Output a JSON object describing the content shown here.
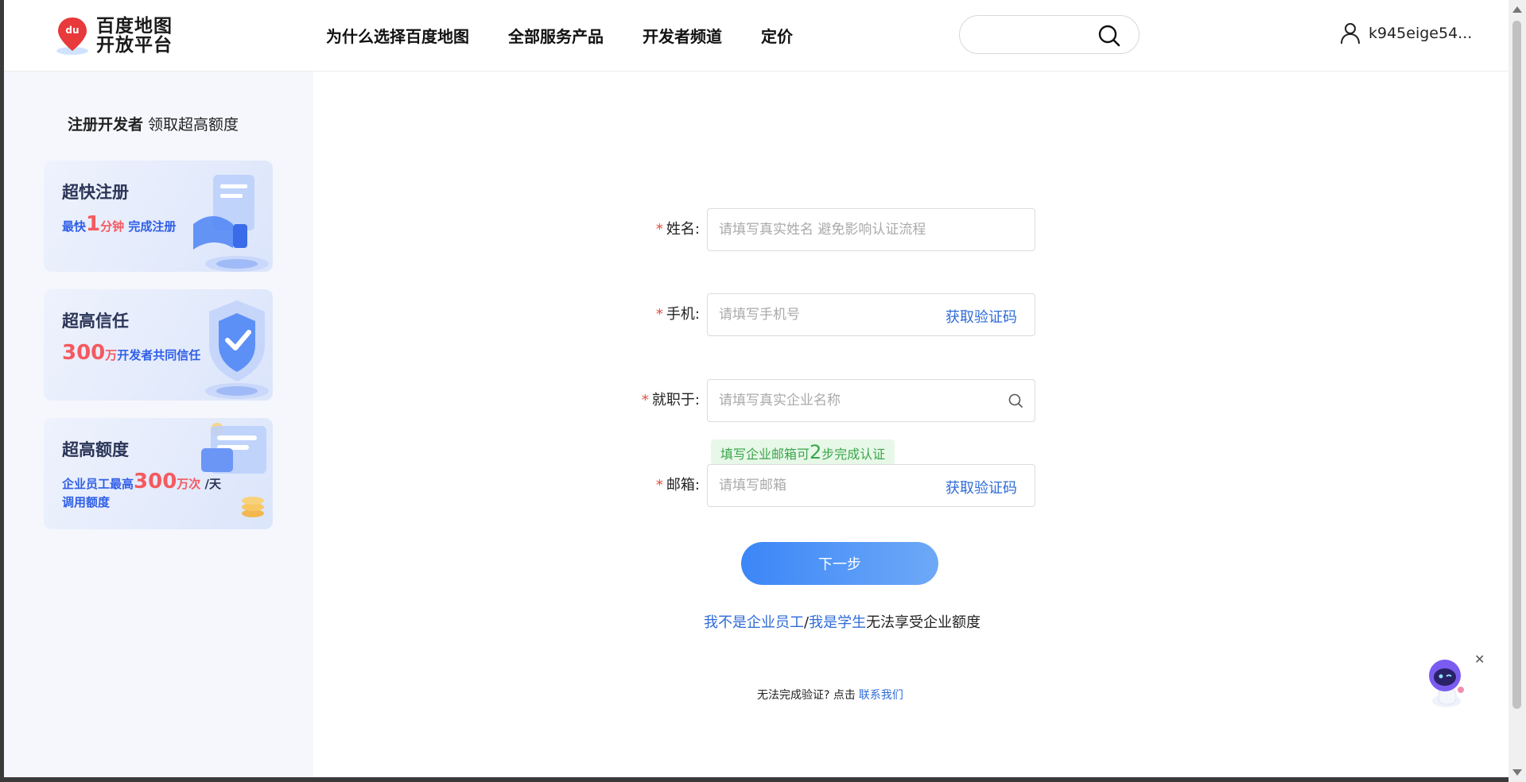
{
  "header": {
    "logo_line1": "百度地图",
    "logo_line2": "开放平台",
    "logo_badge": "du",
    "nav": [
      "为什么选择百度地图",
      "全部服务产品",
      "开发者频道",
      "定价"
    ],
    "search_value": "",
    "username": "k945eige54..."
  },
  "sidebar": {
    "title_bold": "注册开发者",
    "title_rest": "领取超高额度",
    "cards": [
      {
        "title": "超快注册",
        "pre": "最快",
        "big": "1",
        "red": "分钟",
        "post": "完成注册",
        "line2": ""
      },
      {
        "title": "超高信任",
        "pre": "",
        "big": "300",
        "red": "万",
        "post": "开发者共同信任",
        "line2": ""
      },
      {
        "title": "超高额度",
        "pre": "企业员工最高",
        "big": "300",
        "red": "万次",
        "post": "/天",
        "line2": "调用额度"
      }
    ]
  },
  "form": {
    "required_mark": "*",
    "name_label": "姓名:",
    "name_placeholder": "请填写真实姓名 避免影响认证流程",
    "phone_label": "手机:",
    "phone_placeholder": "请填写手机号",
    "get_code": "获取验证码",
    "company_label": "就职于:",
    "company_placeholder": "请填写真实企业名称",
    "tip_pre": "填写企业邮箱可",
    "tip_num": "2",
    "tip_post": "步完成认证",
    "email_label": "邮箱:",
    "email_placeholder": "请填写邮箱",
    "next_button": "下一步",
    "not_employee": "我不是企业员工",
    "slash": "/",
    "student": "我是学生",
    "no_quota": "无法享受企业额度",
    "help_text": "无法完成验证? 点击",
    "contact_us": "联系我们"
  },
  "colors": {
    "accent": "#2f6bd8",
    "required": "#e74c3c",
    "tip_green": "#3aa54a",
    "highlight_red": "#f45a5f"
  },
  "icons": [
    "search-icon",
    "user-icon",
    "map-pin-logo",
    "robot-assistant-icon",
    "close-icon"
  ]
}
